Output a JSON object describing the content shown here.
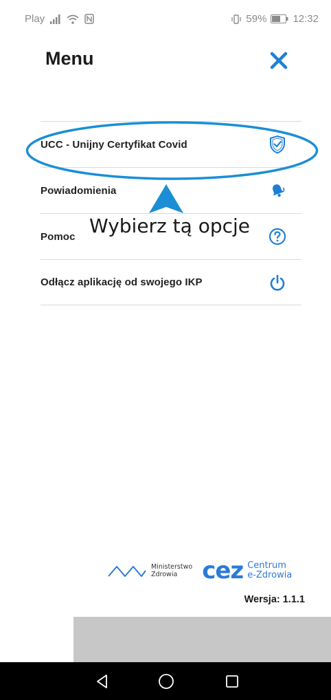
{
  "status_bar": {
    "carrier": "Play",
    "battery": "59%",
    "time": "12:32"
  },
  "header": {
    "title": "Menu",
    "close_icon": "close-icon"
  },
  "menu": {
    "items": [
      {
        "label": "UCC - Unijny Certyfikat Covid",
        "icon": "shield-check-icon"
      },
      {
        "label": "Powiadomienia",
        "icon": "bell-icon"
      },
      {
        "label": "Pomoc",
        "icon": "help-circle-icon"
      },
      {
        "label": "Odłącz aplikację od swojego IKP",
        "icon": "power-icon"
      }
    ]
  },
  "annotation": {
    "hint": "Wybierz tą opcje"
  },
  "footer": {
    "ministry_line1": "Ministerstwo",
    "ministry_line2": "Zdrowia",
    "cez_mark": "cez",
    "cez_line1": "Centrum",
    "cez_line2": "e-Zdrowia",
    "version": "Wersja: 1.1.1"
  },
  "colors": {
    "accent": "#1f7fd6",
    "highlight": "#1b8ed6",
    "grey_block": "#c7c7c7"
  }
}
